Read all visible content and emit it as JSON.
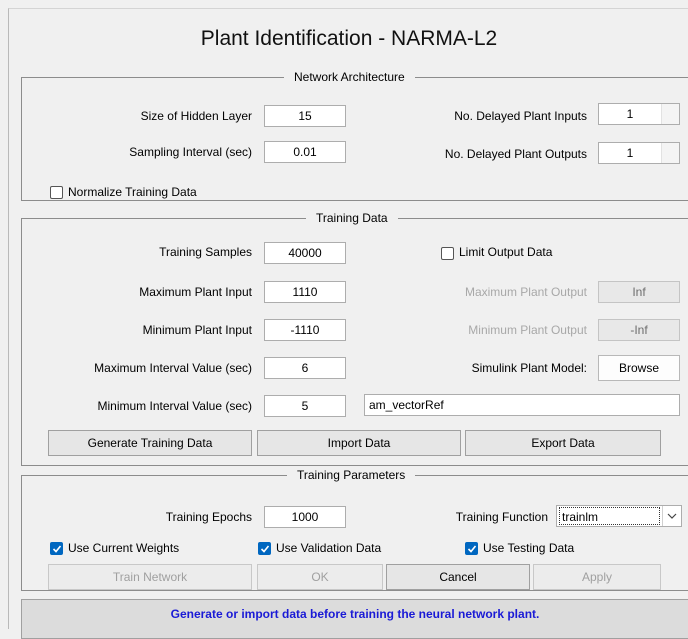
{
  "window": {
    "title": "Plant Identification - NARMA-L2"
  },
  "network_architecture": {
    "title": "Network Architecture",
    "hidden_layer_label": "Size of Hidden Layer",
    "hidden_layer_value": "15",
    "sampling_label": "Sampling Interval (sec)",
    "sampling_value": "0.01",
    "delayed_inputs_label": "No. Delayed Plant Inputs",
    "delayed_inputs_value": "1",
    "delayed_outputs_label": "No. Delayed Plant Outputs",
    "delayed_outputs_value": "1",
    "normalize_label": "Normalize Training Data",
    "normalize_checked": false
  },
  "training_data": {
    "title": "Training Data",
    "samples_label": "Training Samples",
    "samples_value": "40000",
    "limit_output_label": "Limit Output Data",
    "limit_output_checked": false,
    "max_input_label": "Maximum Plant Input",
    "max_input_value": "1110",
    "max_output_label": "Maximum Plant Output",
    "max_output_value": "Inf",
    "min_input_label": "Minimum Plant Input",
    "min_input_value": "-1110",
    "min_output_label": "Minimum Plant Output",
    "min_output_value": "-Inf",
    "max_interval_label": "Maximum Interval Value (sec)",
    "max_interval_value": "6",
    "simulink_label": "Simulink Plant Model:",
    "browse_label": "Browse",
    "min_interval_label": "Minimum Interval Value (sec)",
    "min_interval_value": "5",
    "model_name_value": "am_vectorRef",
    "generate_label": "Generate Training Data",
    "import_label": "Import Data",
    "export_label": "Export Data"
  },
  "training_parameters": {
    "title": "Training Parameters",
    "epochs_label": "Training Epochs",
    "epochs_value": "1000",
    "function_label": "Training Function",
    "function_value": "trainlm",
    "use_current_weights_label": "Use Current Weights",
    "use_validation_label": "Use Validation Data",
    "use_testing_label": "Use Testing Data",
    "train_label": "Train Network",
    "ok_label": "OK",
    "cancel_label": "Cancel",
    "apply_label": "Apply"
  },
  "status": {
    "message": "Generate or import data before training the neural network plant."
  },
  "colors": {
    "accent": "#0067c0",
    "status_text": "#1a1ad6",
    "background": "#f0f0f0"
  }
}
